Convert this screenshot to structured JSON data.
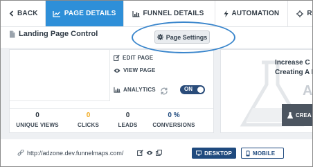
{
  "nav": {
    "back_label": "BACK",
    "tabs": [
      {
        "label": "PAGE DETAILS",
        "icon": "line-chart-icon",
        "active": true
      },
      {
        "label": "FUNNEL DETAILS",
        "icon": "bar-chart-icon",
        "active": false
      },
      {
        "label": "AUTOMATION",
        "icon": "lightning-icon",
        "active": false
      },
      {
        "label": "RETARGETING",
        "icon": "crosshair-icon",
        "active": false
      }
    ]
  },
  "page": {
    "title": "Landing Page Control",
    "settings_button": "Page Settings"
  },
  "actions": {
    "edit_page": "EDIT PAGE",
    "view_page": "VIEW PAGE",
    "analytics": "ANALYTICS",
    "toggle_state": "ON"
  },
  "stats": [
    {
      "value": "0",
      "label": "UNIQUE VIEWS",
      "color": "#2c3640"
    },
    {
      "value": "0",
      "label": "CLICKS",
      "color": "#f0a81c"
    },
    {
      "value": "0",
      "label": "LEADS",
      "color": "#2c3640"
    },
    {
      "value": "0 %",
      "label": "CONVERSIONS",
      "color": "#1f4a7e"
    }
  ],
  "promo": {
    "line1": "Increase C",
    "line2": "Creating A F",
    "big_letter": "A",
    "button": "CREA"
  },
  "url_bar": {
    "url": "http://adzone.dev.funnelmaps.com/",
    "desktop_label": "DESKTOP",
    "mobile_label": "MOBILE"
  },
  "colors": {
    "accent": "#2e8fd8",
    "navy": "#1f4a7e",
    "clicks_orange": "#f0a81c",
    "highlight_ellipse": "#3a86cc"
  }
}
